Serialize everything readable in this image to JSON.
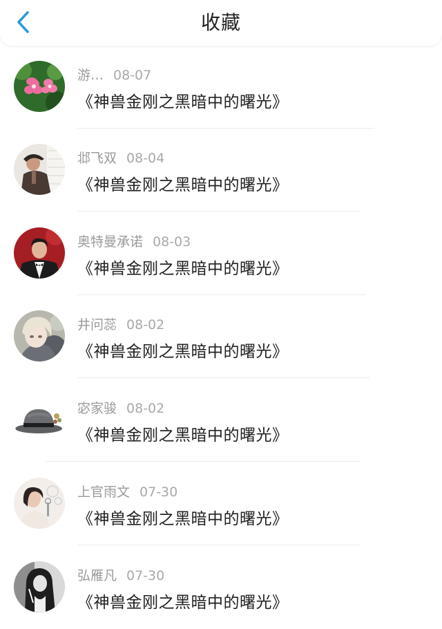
{
  "header": {
    "title": "收藏",
    "back_icon": "chevron-left-icon",
    "accent_color": "#2a9ae0"
  },
  "favorites": [
    {
      "name": "游…",
      "date": "08-07",
      "title": "《神兽金刚之黑暗中的曙光》",
      "avatar": "flower-avatar"
    },
    {
      "name": "邶飞双",
      "date": "08-04",
      "title": "《神兽金刚之黑暗中的曙光》",
      "avatar": "man-with-hat-avatar"
    },
    {
      "name": "奥特曼承诺",
      "date": "08-03",
      "title": "《神兽金刚之黑暗中的曙光》",
      "avatar": "man-in-tuxedo-avatar"
    },
    {
      "name": "井问蕊",
      "date": "08-02",
      "title": "《神兽金刚之黑暗中的曙光》",
      "avatar": "anime-character-avatar"
    },
    {
      "name": "宓家骏",
      "date": "08-02",
      "title": "《神兽金刚之黑暗中的曙光》",
      "avatar": "fedora-hat-avatar"
    },
    {
      "name": "上官雨文",
      "date": "07-30",
      "title": "《神兽金刚之黑暗中的曙光》",
      "avatar": "girl-with-bubbles-avatar"
    },
    {
      "name": "弘雁凡",
      "date": "07-30",
      "title": "《神兽金刚之黑暗中的曙光》",
      "avatar": "girl-with-long-hair-avatar"
    }
  ]
}
